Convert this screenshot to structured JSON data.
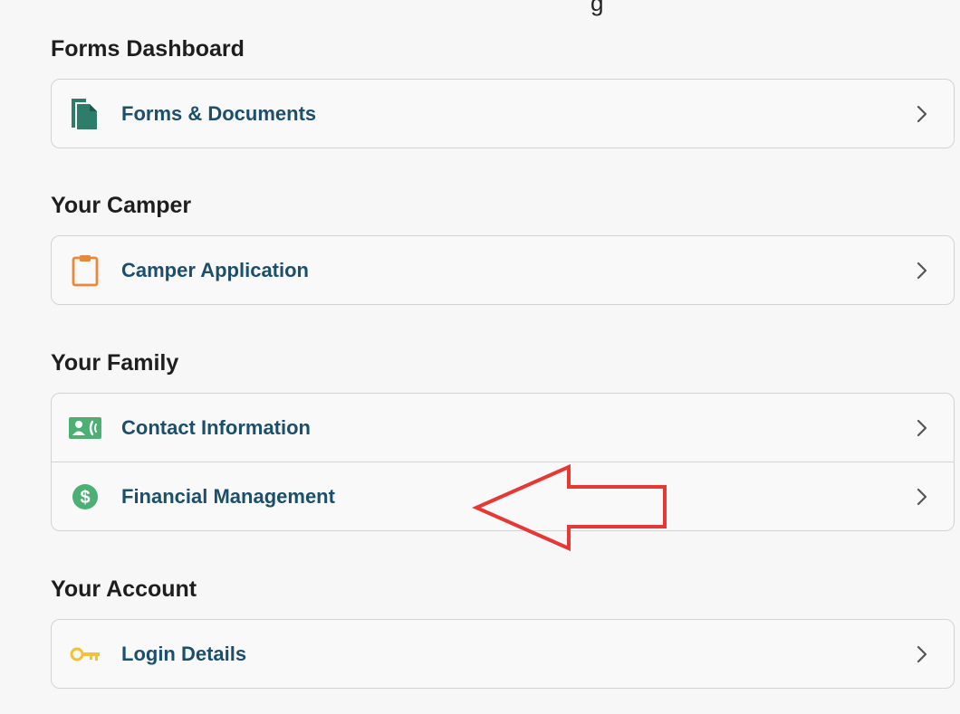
{
  "top_fragment": "g",
  "sections": {
    "forms": {
      "title": "Forms Dashboard",
      "items": [
        {
          "label": "Forms & Documents",
          "icon": "documents-icon"
        }
      ]
    },
    "camper": {
      "title": "Your Camper",
      "items": [
        {
          "label": "Camper Application",
          "icon": "clipboard-icon"
        }
      ]
    },
    "family": {
      "title": "Your Family",
      "items": [
        {
          "label": "Contact Information",
          "icon": "contact-card-icon"
        },
        {
          "label": "Financial Management",
          "icon": "dollar-circle-icon"
        }
      ]
    },
    "account": {
      "title": "Your Account",
      "items": [
        {
          "label": "Login Details",
          "icon": "key-icon"
        }
      ]
    }
  },
  "colors": {
    "label": "#1c4f6b",
    "teal_icon": "#2e7d6b",
    "orange_icon": "#e8883a",
    "green_icon": "#4caf73",
    "yellow_icon": "#f2c230",
    "annotation_red": "#e53935"
  }
}
